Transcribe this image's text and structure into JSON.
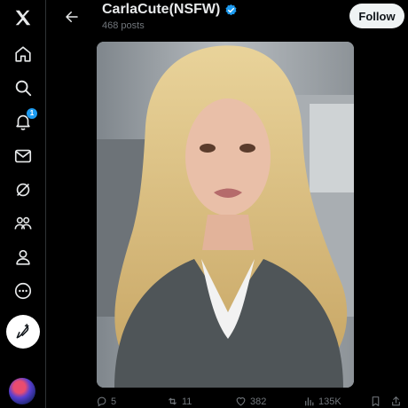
{
  "sidebar": {
    "items": [
      {
        "icon": "x-logo-icon"
      },
      {
        "icon": "home-icon"
      },
      {
        "icon": "search-icon"
      },
      {
        "icon": "notifications-icon",
        "badge": "1"
      },
      {
        "icon": "messages-icon"
      },
      {
        "icon": "grok-icon"
      },
      {
        "icon": "communities-icon"
      },
      {
        "icon": "profile-icon"
      },
      {
        "icon": "more-icon"
      }
    ],
    "post_button_icon": "compose-post-icon",
    "avatar_icon": "account-avatar"
  },
  "header": {
    "back_icon": "back-arrow-icon",
    "title": "CarlaCute(NSFW)",
    "verified_icon": "verified-badge-icon",
    "subtitle": "468 posts",
    "follow_label": "Follow"
  },
  "media": {
    "description_icon": "photo"
  },
  "actions": {
    "replies": "5",
    "reposts": "11",
    "likes": "382",
    "views": "135K"
  },
  "colors": {
    "background": "#000000",
    "accent": "#1d9bf0",
    "muted": "#71767b",
    "follow_bg": "#eff3f4"
  }
}
